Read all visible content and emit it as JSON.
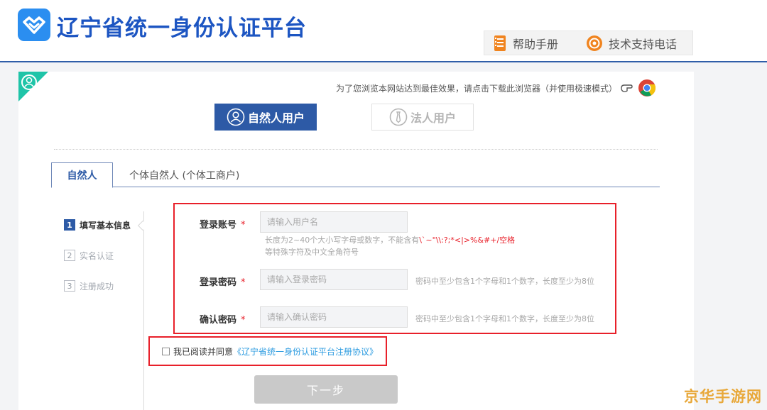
{
  "header": {
    "site_title": "辽宁省统一身份认证平台",
    "help_manual": "帮助手册",
    "tech_support": "技术支持电话"
  },
  "browser_tip": "为了您浏览本网站达到最佳效果，请点击下载此浏览器（并使用极速模式）",
  "user_types": {
    "natural": "自然人用户",
    "legal": "法人用户"
  },
  "tabs": {
    "natural": "自然人",
    "individual": "个体自然人 (个体工商户)"
  },
  "steps": [
    {
      "num": "1",
      "label": "填写基本信息"
    },
    {
      "num": "2",
      "label": "实名认证"
    },
    {
      "num": "3",
      "label": "注册成功"
    }
  ],
  "form": {
    "account_label": "登录账号",
    "account_placeholder": "请输入用户名",
    "account_hint_1": "长度为2~40个大小写字母或数字，不能含有",
    "account_hint_red": "\\`~\"\\\\:?;*<|>%&#+/空格",
    "account_hint_2": "等特殊字符及中文全角符号",
    "password_label": "登录密码",
    "password_placeholder": "请输入登录密码",
    "password_hint": "密码中至少包含1个字母和1个数字，长度至少为8位",
    "confirm_label": "确认密码",
    "confirm_placeholder": "请输入确认密码",
    "confirm_hint": "密码中至少包含1个字母和1个数字，长度至少为8位",
    "required_mark": "*"
  },
  "agreement": {
    "text": "我已阅读并同意",
    "link": "《辽宁省统一身份认证平台注册协议》"
  },
  "next_button": "下一步",
  "watermark": "京华手游网",
  "colors": {
    "brand_blue": "#2d5aa6",
    "title_blue": "#1c55c2",
    "highlight_red": "#e8202a",
    "link_blue": "#2b9be0"
  }
}
